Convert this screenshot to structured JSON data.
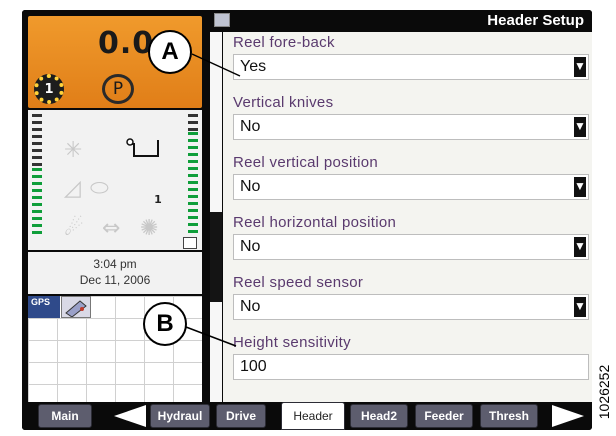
{
  "status": {
    "speed": "0.0",
    "gear": "1",
    "park": "P",
    "time": "3:04 pm",
    "date": "Dec 11, 2006",
    "header_count": "1",
    "gps_label": "GPS",
    "levels": [
      0.55,
      0.85
    ]
  },
  "page": {
    "title": "Header Setup"
  },
  "settings": [
    {
      "label": "Reel fore-back",
      "value": "Yes",
      "has_dropdown": true
    },
    {
      "label": "Vertical knives",
      "value": "No",
      "has_dropdown": true
    },
    {
      "label": "Reel vertical position",
      "value": "No",
      "has_dropdown": true
    },
    {
      "label": "Reel horizontal position",
      "value": "No",
      "has_dropdown": true
    },
    {
      "label": "Reel speed sensor",
      "value": "No",
      "has_dropdown": true
    },
    {
      "label": "Height sensitivity",
      "value": "100",
      "has_dropdown": false
    }
  ],
  "tabs": [
    {
      "label": "Main"
    },
    {
      "label": "Hydraul"
    },
    {
      "label": "Drive"
    },
    {
      "label": "Header",
      "active": true
    },
    {
      "label": "Head2"
    },
    {
      "label": "Feeder"
    },
    {
      "label": "Thresh"
    }
  ],
  "callouts": {
    "a": "A",
    "b": "B"
  },
  "figure_id": "1026252",
  "colors": {
    "status_orange": "#f09a2c",
    "label_purple": "#5a3a6e",
    "tab_gray": "#5d5d6e",
    "level_green": "#0f9e3a"
  }
}
